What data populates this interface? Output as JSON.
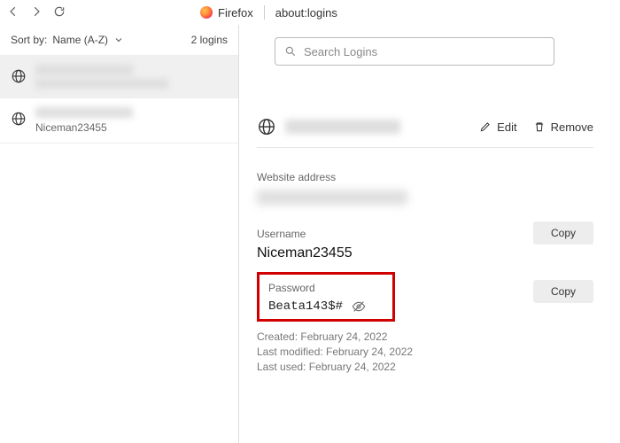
{
  "browser": {
    "tab_title": "Firefox",
    "address": "about:logins"
  },
  "sidebar": {
    "sort_label": "Sort by:",
    "sort_value": "Name (A-Z)",
    "count_text": "2 logins",
    "items": [
      {
        "sub": ""
      },
      {
        "sub": "Niceman23455"
      }
    ]
  },
  "search": {
    "placeholder": "Search Logins"
  },
  "detail": {
    "edit_label": "Edit",
    "remove_label": "Remove",
    "website_label": "Website address",
    "username_label": "Username",
    "username_value": "Niceman23455",
    "password_label": "Password",
    "password_value": "Beata143$#",
    "copy_label": "Copy",
    "meta": {
      "created": "Created: February 24, 2022",
      "modified": "Last modified: February 24, 2022",
      "used": "Last used: February 24, 2022"
    }
  }
}
